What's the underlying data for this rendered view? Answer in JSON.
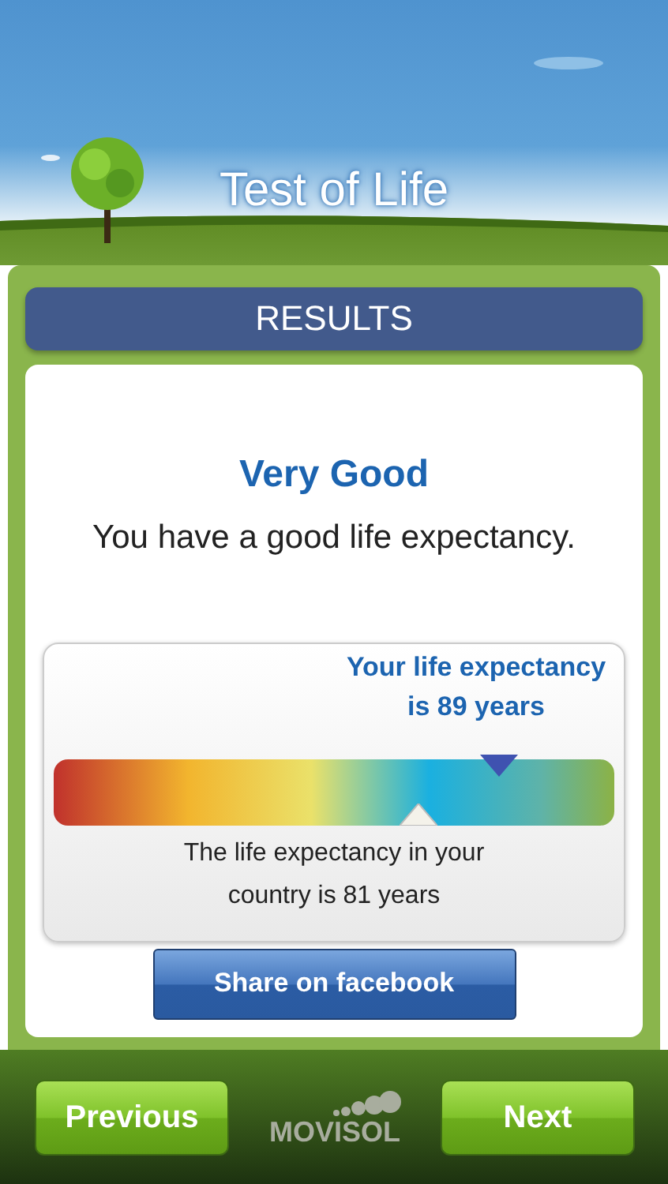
{
  "header": {
    "title": "Test of Life"
  },
  "section_title": "RESULTS",
  "result": {
    "rating": "Very Good",
    "summary": "You have a good life expectancy."
  },
  "gauge": {
    "your_marker": {
      "label": "Your life expectancy is 89 years",
      "level": 0.795
    },
    "country_marker": {
      "label": "The life expectancy in your country is 81 years",
      "level": 0.65
    }
  },
  "share_button": "Share on facebook",
  "footer": {
    "previous": "Previous",
    "logo": "MOVISOL",
    "next": "Next"
  }
}
